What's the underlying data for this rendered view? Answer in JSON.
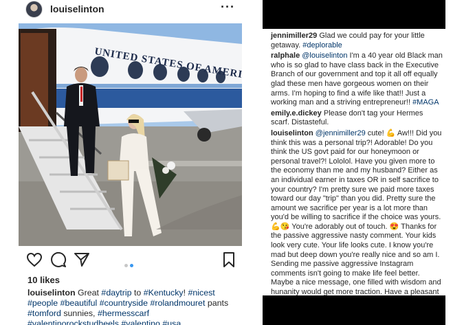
{
  "post": {
    "username": "louiselinton",
    "more_icon": "more-options-icon",
    "likes": "10 likes",
    "caption_user": "louiselinton",
    "caption_parts": [
      {
        "t": "Great ",
        "tag": false
      },
      {
        "t": "#daytrip",
        "tag": true
      },
      {
        "t": " to ",
        "tag": false
      },
      {
        "t": "#Kentucky",
        "tag": true
      },
      {
        "t": "! ",
        "tag": false
      },
      {
        "t": "#nicest",
        "tag": true
      },
      {
        "t": " ",
        "tag": false
      },
      {
        "t": "#people",
        "tag": true
      },
      {
        "t": " ",
        "tag": false
      },
      {
        "t": "#beautiful",
        "tag": true
      },
      {
        "t": " ",
        "tag": false
      },
      {
        "t": "#countryside",
        "tag": true
      },
      {
        "t": " ",
        "tag": false
      },
      {
        "t": "#rolandmouret",
        "tag": true
      },
      {
        "t": " pants ",
        "tag": false
      },
      {
        "t": "#tomford",
        "tag": true
      },
      {
        "t": " sunnies, ",
        "tag": false
      },
      {
        "t": "#hermesscarf",
        "tag": true
      },
      {
        "t": " ",
        "tag": false
      },
      {
        "t": "#valentinorockstudheels",
        "tag": true
      },
      {
        "t": " ",
        "tag": false
      },
      {
        "t": "#valentino",
        "tag": true
      },
      {
        "t": " ",
        "tag": false
      },
      {
        "t": "#usa",
        "tag": true
      }
    ],
    "photo_text": "UNITED STATES OF AMERICA",
    "carousel_count": 2,
    "carousel_active": 2
  },
  "comments": [
    {
      "user": "jennimiller29",
      "parts": [
        {
          "t": "Glad we could pay for your little getaway. ",
          "tag": false
        },
        {
          "t": "#deplorable",
          "tag": true
        }
      ]
    },
    {
      "user": "ralphale",
      "parts": [
        {
          "t": "@louiselinton",
          "tag": true
        },
        {
          "t": " I'm a 40 year old Black man who is so glad to have class back in the Executive Branch of our government and top it all off equally glad these men have gorgeous women on their arms. I'm hoping to find a wife like that!! Just a working man and a striving entrepreneur!! ",
          "tag": false
        },
        {
          "t": "#MAGA",
          "tag": true
        }
      ]
    },
    {
      "user": "emily.e.dickey",
      "parts": [
        {
          "t": "Please don't tag your Hermes scarf. Distasteful.",
          "tag": false
        }
      ]
    },
    {
      "user": "louiselinton",
      "parts": [
        {
          "t": "@jennimiller29",
          "tag": true
        },
        {
          "t": " cute! 💪 Aw!!! Did you think this was a personal trip?! Adorable! Do you think the US govt paid for our honeymoon or personal travel?! Lololol. Have you given more to the economy than me and my husband? Either as an individual earner in taxes OR in self sacrifice to your country? I'm pretty sure we paid more taxes toward our day \"trip\" than you did. Pretty sure the amount we sacrifice per year is a lot more than you'd be willing to sacrifice if the choice was yours. 💪😘 You're adorably out of touch. 😍 Thanks for the passive aggressive nasty comment. Your kids look very cute. Your life looks cute. I know you're mad but deep down you're really nice and so am I. Sending me passive aggressive Instagram comments isn't going to make life feel better. Maybe a nice message, one filled with wisdom and hunanity would get more traction. Have a pleasant evening. Go chill out and watch the new game of thrones. It's fab!",
          "tag": false
        }
      ]
    }
  ],
  "colors": {
    "hashtag": "#003569",
    "carousel_active": "#3897f0",
    "text": "#262626"
  }
}
